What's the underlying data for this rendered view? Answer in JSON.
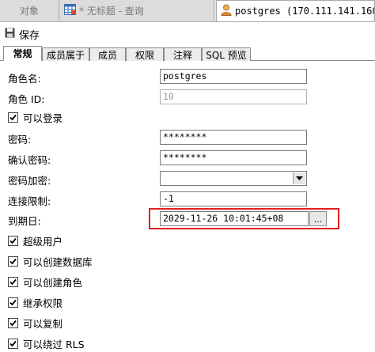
{
  "doc_tabs": {
    "objects": "对象",
    "query": "* 无标题 - 查询",
    "role": "postgres (170.111.141.160..."
  },
  "toolbar": {
    "save_label": "保存"
  },
  "prop_tabs": [
    "常规",
    "成员属于",
    "成员",
    "权限",
    "注释",
    "SQL 预览"
  ],
  "form": {
    "role_name": {
      "label": "角色名:",
      "value": "postgres"
    },
    "role_id": {
      "label": "角色 ID:",
      "value": "10"
    },
    "can_login": {
      "label": "可以登录",
      "checked": true
    },
    "password": {
      "label": "密码:",
      "value": "********"
    },
    "confirm_password": {
      "label": "确认密码:",
      "value": "********"
    },
    "password_encryption": {
      "label": "密码加密:",
      "value": ""
    },
    "connection_limit": {
      "label": "连接限制:",
      "value": "-1"
    },
    "expiry_date": {
      "label": "到期日:",
      "value": "2029-11-26 10:01:45+08",
      "picker_label": "..."
    },
    "checkboxes": [
      {
        "label": "超级用户",
        "checked": true
      },
      {
        "label": "可以创建数据库",
        "checked": true
      },
      {
        "label": "可以创建角色",
        "checked": true
      },
      {
        "label": "继承权限",
        "checked": true
      },
      {
        "label": "可以复制",
        "checked": true
      },
      {
        "label": "可以绕过 RLS",
        "checked": true
      }
    ]
  },
  "colors": {
    "highlight": "#e02020"
  }
}
